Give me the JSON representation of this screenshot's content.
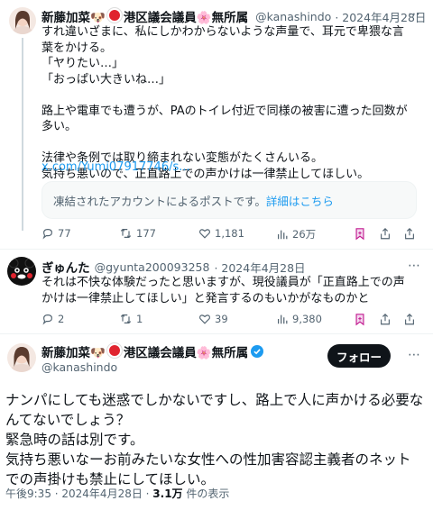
{
  "tweet1": {
    "name": "新藤加菜",
    "name_suffix": "港区議会議員",
    "name_tail": "無所属",
    "handle": "@kanashindo",
    "date": "· 2024年4月28日",
    "text": "すれ違いざまに、私にしかわからないような声量で、耳元で卑猥な言葉をかける。\n「ヤりたい…」\n「おっぱい大きいね…」\n\n路上や電車でも遭うが、PAのトイレ付近で同様の被害に遭った回数が多い。\n\n法律や条例では取り締まれない変態がたくさんいる。\n気持ち悪いので、正直路上での声かけは一律禁止してほしい。",
    "link": "x.com/Yumi07917746/s...",
    "notice_text": "凍結されたアカウントによるポストです。",
    "notice_link": "詳細はこちら",
    "replies": "77",
    "retweets": "177",
    "likes": "1,181",
    "views": "26万"
  },
  "reply": {
    "name": "ぎゅんた",
    "handle": "@gyunta200093258",
    "date": "· 2024年4月28日",
    "text": "それは不快な体験だったと思いますが、現役議員が「正直路上での声かけは一律禁止してほしい」と発言するのもいかがなものかと",
    "replies": "2",
    "retweets": "1",
    "likes": "39",
    "views": "9,380"
  },
  "main": {
    "name": "新藤加菜",
    "name_suffix": "港区議会議員",
    "name_tail": "無所属",
    "handle": "@kanashindo",
    "follow_label": "フォロー",
    "text": "ナンパにしても迷惑でしかないですし、路上で人に声かける必要なんてないでしょう？\n緊急時の話は別です。\n気持ち悪いなーお前みたいな女性への性加害容認主義者のネットでの声掛けも禁止にしてほしい。",
    "time": "午後9:35 · 2024年4月28日 · ",
    "views_count": "3.1万",
    "views_label": " 件の表示"
  },
  "colors": {
    "accent": "#1d9bf0",
    "muted": "#536471",
    "text": "#0f1419"
  }
}
